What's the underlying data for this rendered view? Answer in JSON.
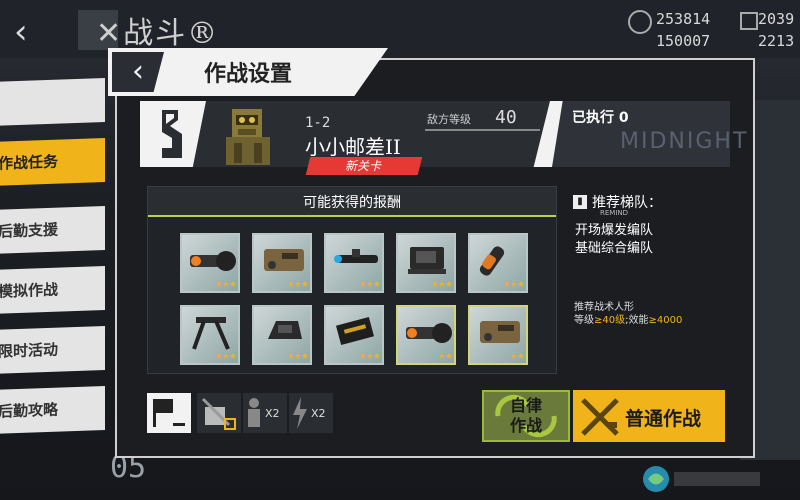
{
  "top": {
    "title": "✕战斗®",
    "resources": [
      "253814",
      "150007",
      "2039",
      "2213"
    ]
  },
  "left_menu": {
    "items": [
      "",
      "作战任务",
      "后勤支援",
      "模拟作战",
      "限时活动",
      "后勤攻略"
    ],
    "bottom_number": "05"
  },
  "dialog": {
    "title": "作战设置",
    "stage": {
      "number": "1-2",
      "name": "小小邮差II",
      "badge": "新关卡",
      "enemy_level_label": "敌方等级",
      "enemy_level": "40",
      "executed": "已执行 0",
      "deco_text": "MIDNIGHT"
    },
    "rewards": {
      "title": "可能获得的报酬",
      "items": [
        {
          "icon": "scope-icon",
          "stars": "★★★",
          "rarity": "normal"
        },
        {
          "icon": "laser-module-icon",
          "stars": "★★★",
          "rarity": "normal"
        },
        {
          "icon": "sniper-scope-icon",
          "stars": "★★★",
          "rarity": "normal"
        },
        {
          "icon": "holo-sight-icon",
          "stars": "★★★",
          "rarity": "normal"
        },
        {
          "icon": "suppressor-icon",
          "stars": "★★★",
          "rarity": "normal"
        },
        {
          "icon": "bipod-icon",
          "stars": "★★★",
          "rarity": "normal"
        },
        {
          "icon": "red-dot-icon",
          "stars": "★★★",
          "rarity": "normal"
        },
        {
          "icon": "ammo-box-icon",
          "stars": "★★★",
          "rarity": "normal"
        },
        {
          "icon": "scope-icon",
          "stars": "★★",
          "rarity": "gold"
        },
        {
          "icon": "laser-module-icon",
          "stars": "★★",
          "rarity": "gold"
        }
      ]
    },
    "recommend": {
      "title": "推荐梯队：",
      "remind": "REMIND",
      "teams": [
        "开场爆发编队",
        "基础综合编队"
      ],
      "doll_title": "推荐战术人形",
      "doll_req_prefix": "等级",
      "doll_level": "≥40级",
      "doll_sep": ";效能",
      "doll_power": "≥4000"
    },
    "bottom": {
      "x2_a": "X2",
      "x2_b": "X2"
    },
    "buttons": {
      "auto_line1": "自律",
      "auto_line2": "作战",
      "normal": "普通作战"
    }
  },
  "colors": {
    "accent_yellow": "#f0b41a",
    "accent_green": "#b8d24a",
    "badge_red": "#e53935"
  }
}
